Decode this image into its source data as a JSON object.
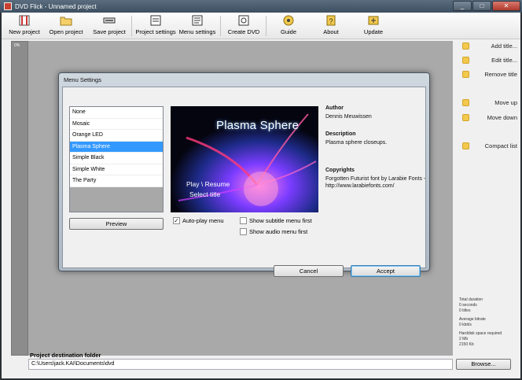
{
  "window": {
    "title": "DVD Flick - Unnamed project",
    "controls": [
      "minimize",
      "maximize",
      "close"
    ]
  },
  "toolbar": [
    {
      "label": "New project",
      "icon": "new-project-icon"
    },
    {
      "label": "Open project",
      "icon": "open-folder-icon"
    },
    {
      "label": "Save project",
      "icon": "save-icon"
    },
    {
      "label": "Project settings",
      "icon": "project-settings-icon"
    },
    {
      "label": "Menu settings",
      "icon": "menu-settings-icon"
    },
    {
      "label": "Create DVD",
      "icon": "create-dvd-icon"
    },
    {
      "label": "Guide",
      "icon": "guide-icon"
    },
    {
      "label": "About",
      "icon": "about-icon"
    },
    {
      "label": "Update",
      "icon": "update-icon"
    }
  ],
  "left_strip": {
    "percent": "0%"
  },
  "right_panel": [
    {
      "label": "Add title...",
      "icon": "plus-icon"
    },
    {
      "label": "Edit title...",
      "icon": "edit-icon"
    },
    {
      "label": "Remove title",
      "icon": "minus-icon"
    },
    {
      "label": "Move up",
      "icon": "arrow-up-icon"
    },
    {
      "label": "Move down",
      "icon": "arrow-down-icon"
    },
    {
      "label": "Compact list",
      "icon": "compact-list-icon"
    }
  ],
  "stats": {
    "total_duration_label": "Total duration",
    "total_duration_seconds": "0 seconds",
    "total_duration_titles": "0 titles",
    "avg_bitrate_label": "Average bitrate",
    "avg_bitrate_value": "0 kbit/s",
    "harddisk_label": "Harddisk space required",
    "harddisk_mb": "2 Mb",
    "harddisk_kb": "2150 Kb"
  },
  "destination": {
    "label": "Project destination folder",
    "value": "C:\\Users\\jack.KAI\\Documents\\dvd",
    "browse_label": "Browse..."
  },
  "dialog": {
    "title": "Menu Settings",
    "menus": [
      "None",
      "Mosaic",
      "Orange LED",
      "Plasma Sphere",
      "Simple Black",
      "Simple White",
      "The Party"
    ],
    "selected_index": 3,
    "preview_label": "Preview",
    "preview_image": {
      "title": "Plasma Sphere",
      "line1": "Play \\ Resume",
      "line2": "Select title"
    },
    "author_label": "Author",
    "author_value": "Dennis Meuwissen",
    "description_label": "Description",
    "description_value": "Plasma sphere closeups.",
    "copyrights_label": "Copyrights",
    "copyrights_value": "Forgotten Futurist font by Larabie Fonts - http://www.larabiefonts.com/",
    "autoplay_label": "Auto-play menu",
    "autoplay_checked": true,
    "subtitle_first_label": "Show subtitle menu first",
    "subtitle_first_checked": false,
    "audio_first_label": "Show audio menu first",
    "audio_first_checked": false,
    "cancel_label": "Cancel",
    "accept_label": "Accept"
  },
  "colors": {
    "selection": "#3399ff",
    "gray_area": "#a9a9a9",
    "titlebar": "#4a5d6f"
  }
}
